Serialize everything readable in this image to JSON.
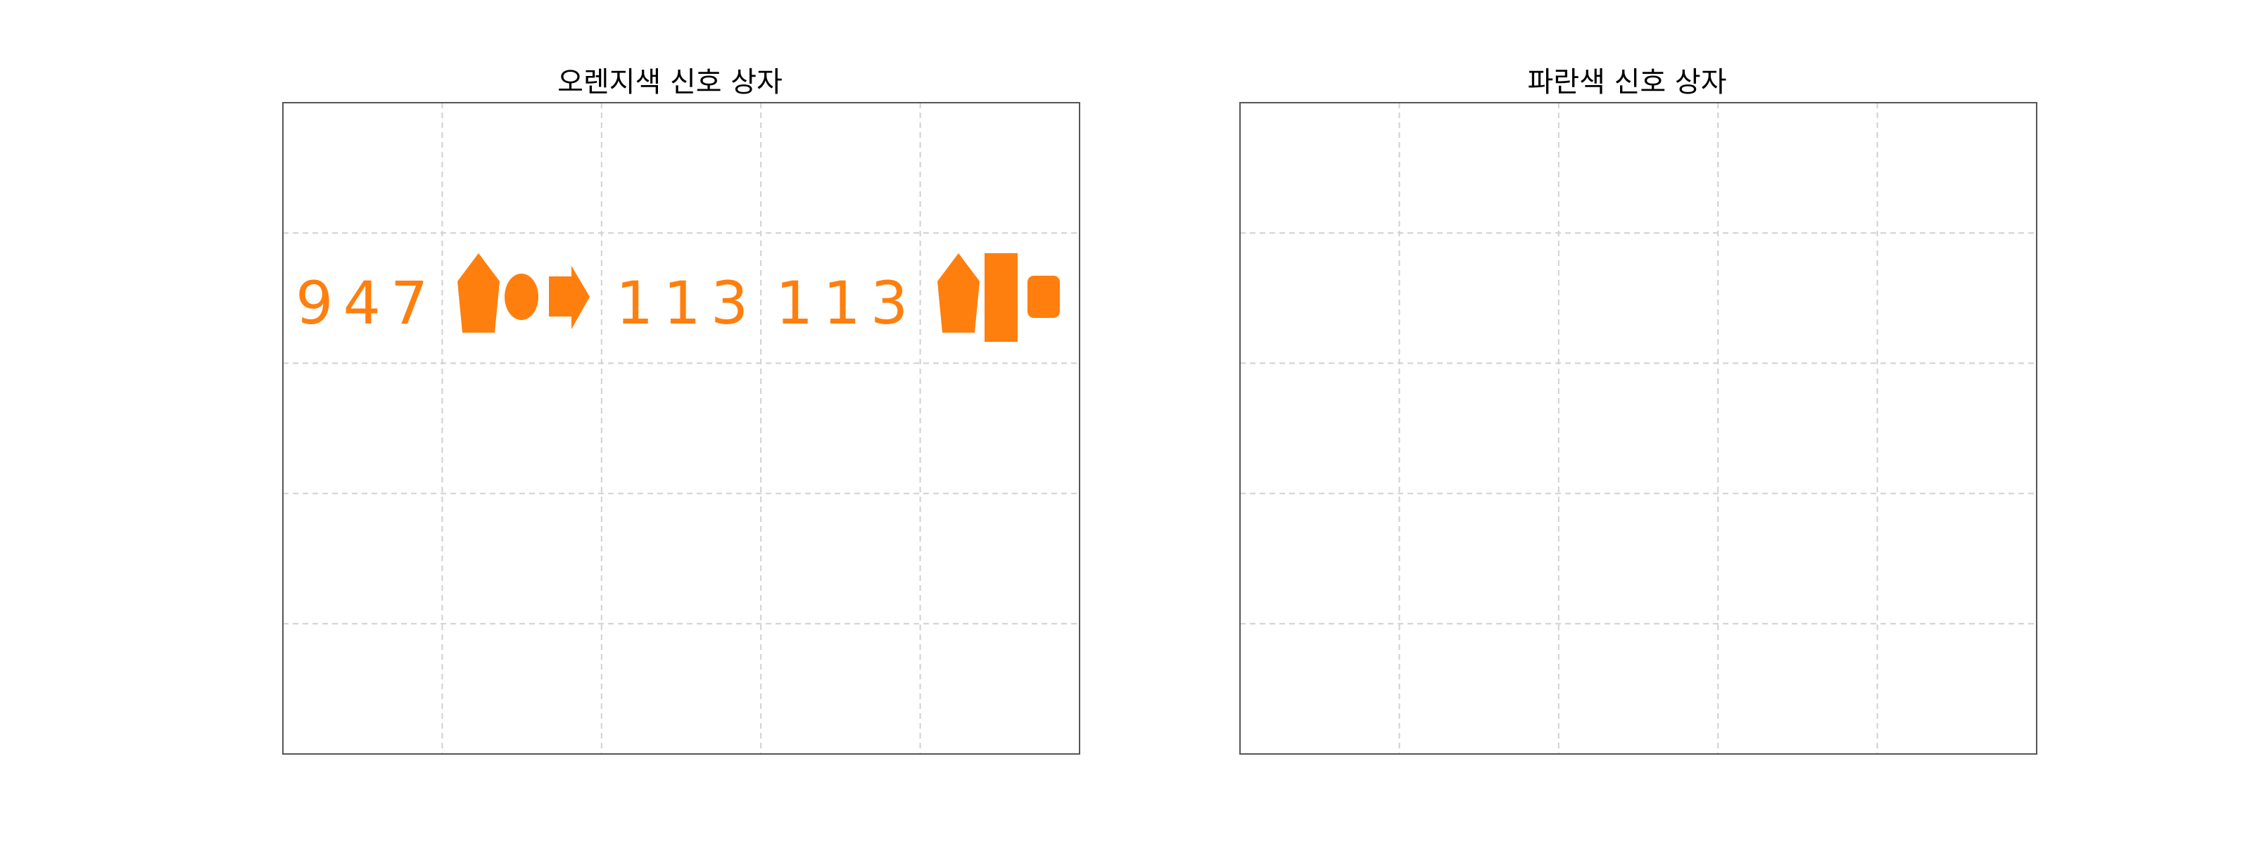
{
  "colors": {
    "orange": "#ff7f0e",
    "grid": "#d0d0d0",
    "border": "#555555"
  },
  "grid": {
    "rows": 5,
    "cols": 5
  },
  "left_box": {
    "title": "오렌지색 신호 상자",
    "row2": [
      {
        "kind": "text",
        "value": "947"
      },
      {
        "kind": "icons",
        "icons": [
          "pentagon-icon",
          "ellipse-icon",
          "arrow-right-icon"
        ]
      },
      {
        "kind": "text",
        "value": "113"
      },
      {
        "kind": "text",
        "value": "113"
      },
      {
        "kind": "icons",
        "icons": [
          "pentagon-icon",
          "tall-rectangle-icon",
          "rounded-rectangle-icon"
        ]
      }
    ]
  },
  "right_box": {
    "title": "파란색 신호 상자"
  }
}
